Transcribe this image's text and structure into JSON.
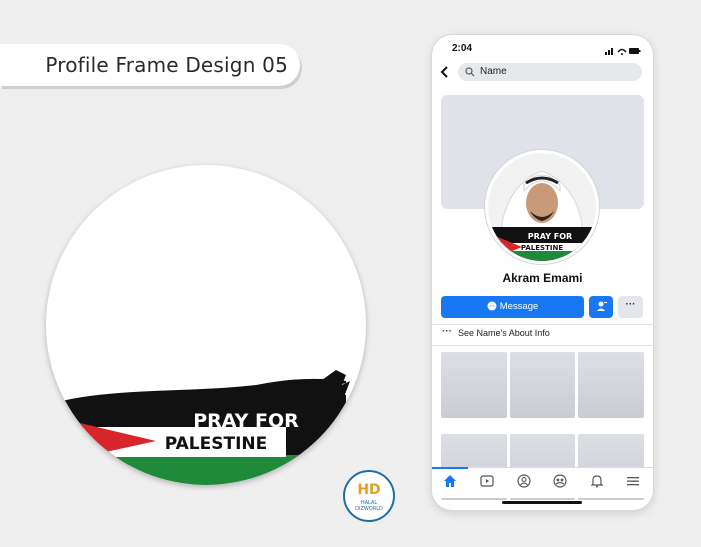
{
  "title": "Profile Frame Design 05",
  "frame_banner": {
    "line1": "PRAY FOR",
    "line2": "PALESTINE"
  },
  "logo": {
    "text1": "HALAL",
    "text2": "DIZWORLD"
  },
  "phone": {
    "status_time": "2:04",
    "search_placeholder": "Name",
    "profile_name": "Akram Emami",
    "message_label": "Message",
    "more_label": "···",
    "about_label": "See Name's About Info",
    "about_dots": "···",
    "tabs": [
      "home-icon",
      "video-icon",
      "profile-icon",
      "groups-icon",
      "bell-icon",
      "menu-icon"
    ]
  },
  "colors": {
    "accent": "#1877f2",
    "flag_red": "#d7262b",
    "flag_green": "#1f8a3a",
    "flag_black": "#111111"
  }
}
